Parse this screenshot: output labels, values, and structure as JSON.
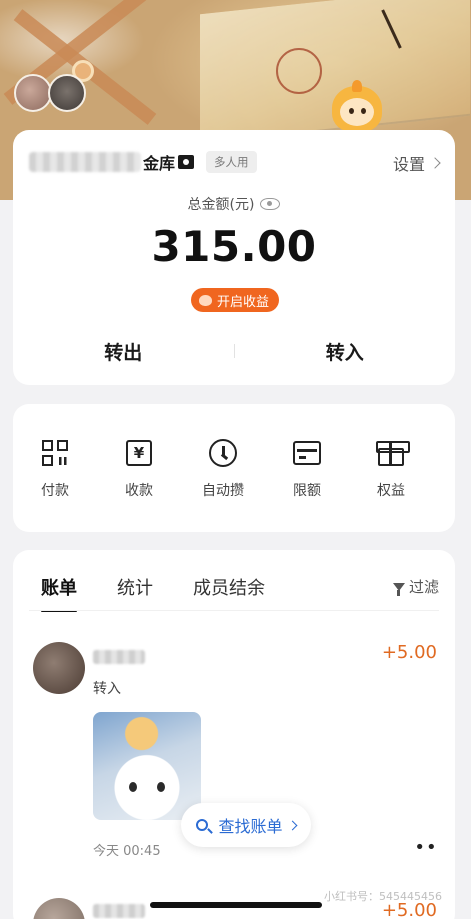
{
  "account": {
    "name_suffix": "金库",
    "multi_user_tag": "多人用",
    "settings_label": "设置",
    "total_label": "总金额(元)",
    "total_amount": "315.00",
    "earnings_button": "开启收益",
    "transfer_out": "转出",
    "transfer_in": "转入"
  },
  "quick_actions": [
    {
      "label": "付款",
      "icon": "qr-code-icon"
    },
    {
      "label": "收款",
      "icon": "yen-receipt-icon"
    },
    {
      "label": "自动攒",
      "icon": "clock-icon"
    },
    {
      "label": "限额",
      "icon": "card-icon"
    },
    {
      "label": "权益",
      "icon": "gift-icon"
    }
  ],
  "bills": {
    "tabs": [
      "账单",
      "统计",
      "成员结余"
    ],
    "active_tab": "账单",
    "filter_label": "过滤",
    "transactions": [
      {
        "type": "转入",
        "amount": "+5.00",
        "time": "今天 00:45"
      },
      {
        "amount": "+5.00"
      }
    ],
    "find_bill_label": "查找账单",
    "more_label": "••"
  },
  "watermark": "小红书号：545445456",
  "colors": {
    "accent_orange": "#f0661f",
    "amount_orange": "#e06a22",
    "link_blue": "#2b6bd3"
  }
}
